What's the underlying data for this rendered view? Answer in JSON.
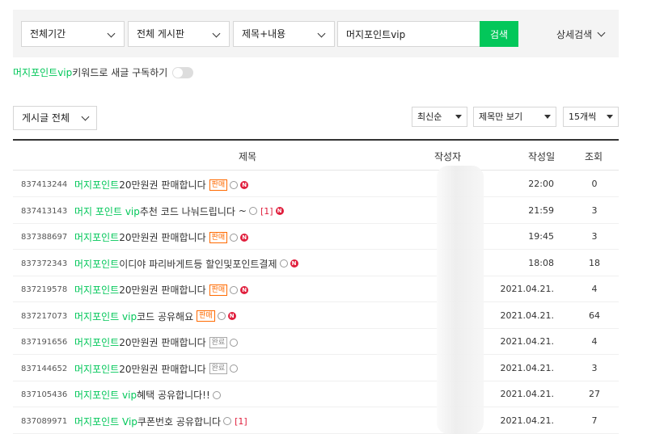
{
  "search": {
    "period": "전체기간",
    "board": "전체 게시판",
    "target": "제목+내용",
    "keyword": "머지포인트vip",
    "button": "검색",
    "detail": "상세검색"
  },
  "subscribe": {
    "keyword": "머지포인트vip",
    "label": " 키워드로 새글 구독하기",
    "enabled": false
  },
  "filters": {
    "board_all": "게시글 전체",
    "sort": "최신순",
    "view": "제목만 보기",
    "count": "15개씩"
  },
  "table": {
    "headers": {
      "title": "제목",
      "author": "작성자",
      "date": "작성일",
      "views": "조회"
    },
    "rows": [
      {
        "num": "837413244",
        "green": "머지포인트",
        "rest": " 20만원권 판매합니다",
        "tag": "판매",
        "tag_type": "sell",
        "cam": true,
        "new": true,
        "comments": "",
        "tilde": false,
        "date": "22:00",
        "views": "0"
      },
      {
        "num": "837413143",
        "green": "머지 포인트 vip",
        "rest": " 추천 코드 나눠드립니다",
        "tag": "",
        "tag_type": "",
        "cam": true,
        "new": true,
        "comments": "[1]",
        "tilde": true,
        "date": "21:59",
        "views": "3"
      },
      {
        "num": "837388697",
        "green": "머지포인트",
        "rest": " 20만원권 판매합니다",
        "tag": "판매",
        "tag_type": "sell",
        "cam": true,
        "new": true,
        "comments": "",
        "tilde": false,
        "date": "19:45",
        "views": "3"
      },
      {
        "num": "837372343",
        "green": "머지포인트",
        "rest": " 이디야 파리바게트등 할인및포인트결제",
        "tag": "",
        "tag_type": "",
        "cam": true,
        "new": true,
        "comments": "",
        "tilde": false,
        "date": "18:08",
        "views": "18"
      },
      {
        "num": "837219578",
        "green": "머지포인트",
        "rest": " 20만원권 판매합니다",
        "tag": "판매",
        "tag_type": "sell",
        "cam": true,
        "new": true,
        "comments": "",
        "tilde": false,
        "date": "2021.04.21.",
        "views": "4"
      },
      {
        "num": "837217073",
        "green": "머지포인트 vip",
        "rest": "코드 공유해요",
        "tag": "판매",
        "tag_type": "sell",
        "cam": true,
        "new": true,
        "comments": "",
        "tilde": false,
        "date": "2021.04.21.",
        "views": "64"
      },
      {
        "num": "837191656",
        "green": "머지포인트",
        "rest": " 20만원권 판매합니다",
        "tag": "완료",
        "tag_type": "done",
        "cam": true,
        "new": false,
        "comments": "",
        "tilde": false,
        "date": "2021.04.21.",
        "views": "4"
      },
      {
        "num": "837144652",
        "green": "머지포인트",
        "rest": " 20만원권 판매합니다",
        "tag": "완료",
        "tag_type": "done",
        "cam": true,
        "new": false,
        "comments": "",
        "tilde": false,
        "date": "2021.04.21.",
        "views": "3"
      },
      {
        "num": "837105436",
        "green": "머지포인트 vip",
        "rest": " 혜택 공유합니다!!",
        "tag": "",
        "tag_type": "",
        "cam": true,
        "new": false,
        "comments": "",
        "tilde": false,
        "date": "2021.04.21.",
        "views": "27"
      },
      {
        "num": "837089971",
        "green": "머지포인트 Vip",
        "rest": "쿠폰번호 공유합니다",
        "tag": "",
        "tag_type": "",
        "cam": true,
        "new": false,
        "comments": "[1]",
        "tilde": false,
        "date": "2021.04.21.",
        "views": "7"
      }
    ]
  },
  "colors": {
    "accent": "#03c75a",
    "new_badge": "#e01e3c",
    "sell_tag": "#ff6a00"
  }
}
